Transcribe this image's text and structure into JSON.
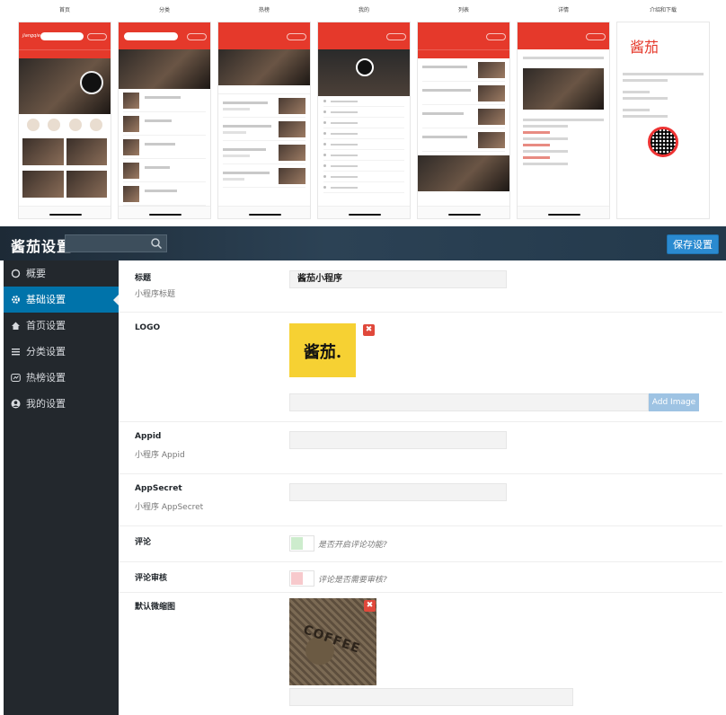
{
  "previews": [
    {
      "caption": "首页",
      "screen": "home"
    },
    {
      "caption": "分类",
      "screen": "category"
    },
    {
      "caption": "热榜",
      "screen": "hot"
    },
    {
      "caption": "我的",
      "screen": "mine"
    },
    {
      "caption": "列表",
      "screen": "list"
    },
    {
      "caption": "详情",
      "screen": "detail"
    },
    {
      "caption": "介绍和下载",
      "screen": "intro"
    }
  ],
  "app": {
    "brand": "酱茄设置",
    "search_placeholder": "",
    "save_label": "保存设置"
  },
  "sidebar": {
    "items": [
      {
        "label": "概要",
        "icon": "circle-icon"
      },
      {
        "label": "基础设置",
        "icon": "gear-icon",
        "active": true
      },
      {
        "label": "首页设置",
        "icon": "home-icon"
      },
      {
        "label": "分类设置",
        "icon": "list-icon"
      },
      {
        "label": "热榜设置",
        "icon": "chart-icon"
      },
      {
        "label": "我的设置",
        "icon": "user-icon"
      }
    ]
  },
  "form": {
    "title": {
      "label": "标题",
      "sub": "小程序标题",
      "value": "酱茄小程序"
    },
    "logo": {
      "label": "LOGO",
      "logo_text": "酱茄.",
      "add_label": "Add Image"
    },
    "appid": {
      "label": "Appid",
      "sub": "小程序 Appid",
      "value": ""
    },
    "appsecret": {
      "label": "AppSecret",
      "sub": "小程序 AppSecret",
      "value": ""
    },
    "comment": {
      "label": "评论",
      "hint": "是否开启评论功能?",
      "knob_color": "#cdeccd"
    },
    "comment_review": {
      "label": "评论审核",
      "hint": "评论是否需要审核?",
      "knob_color": "#f7c9cc"
    },
    "thumb": {
      "label": "默认微缩图",
      "image_text": "COFFEE"
    }
  },
  "colors": {
    "accent": "#0073aa",
    "brand_red": "#e5392b",
    "sidebar_bg": "#23282d"
  }
}
